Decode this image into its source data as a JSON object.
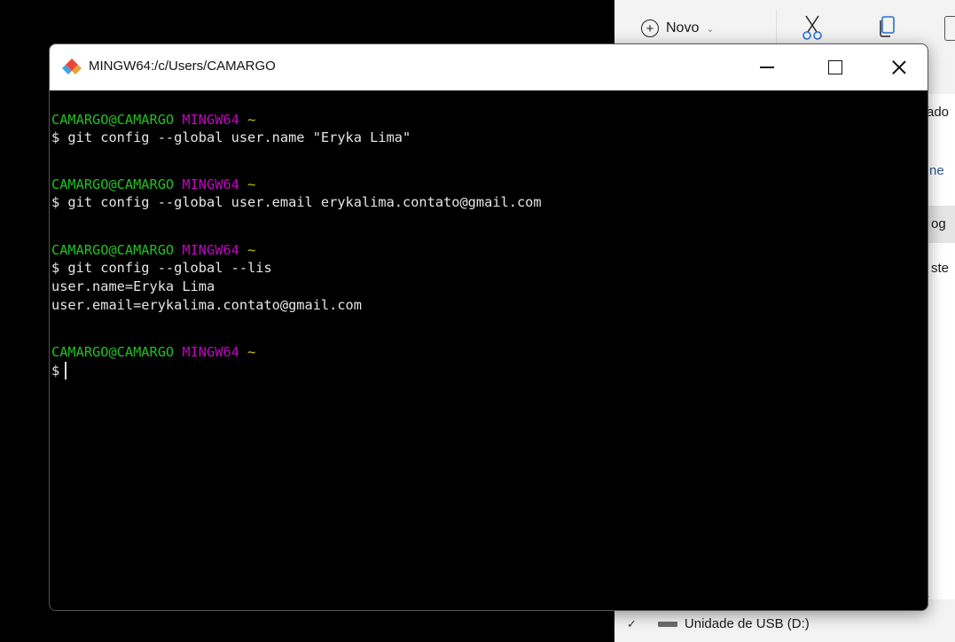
{
  "explorer": {
    "new_button_label": "Novo",
    "side_fragments": [
      "ado",
      "ne",
      "og",
      "ste"
    ],
    "usb_drive_label": "Unidade de USB (D:)"
  },
  "window": {
    "title": "MINGW64:/c/Users/CAMARGO"
  },
  "terminal": {
    "prompts": [
      {
        "user": "CAMARGO@CAMARGO",
        "env": "MINGW64",
        "path": "~",
        "command": "$ git config --global user.name \"Eryka Lima\"",
        "output": []
      },
      {
        "user": "CAMARGO@CAMARGO",
        "env": "MINGW64",
        "path": "~",
        "command": "$ git config --global user.email erykalima.contato@gmail.com",
        "output": []
      },
      {
        "user": "CAMARGO@CAMARGO",
        "env": "MINGW64",
        "path": "~",
        "command": "$ git config --global --lis",
        "output": [
          "user.name=Eryka Lima",
          "user.email=erykalima.contato@gmail.com"
        ]
      },
      {
        "user": "CAMARGO@CAMARGO",
        "env": "MINGW64",
        "path": "~",
        "command": "$",
        "output": []
      }
    ]
  },
  "colors": {
    "prompt_user": "#1ec21e",
    "prompt_env": "#c800c8",
    "prompt_path": "#c9c600",
    "terminal_bg": "#000000",
    "terminal_fg": "#e6e6e6"
  }
}
